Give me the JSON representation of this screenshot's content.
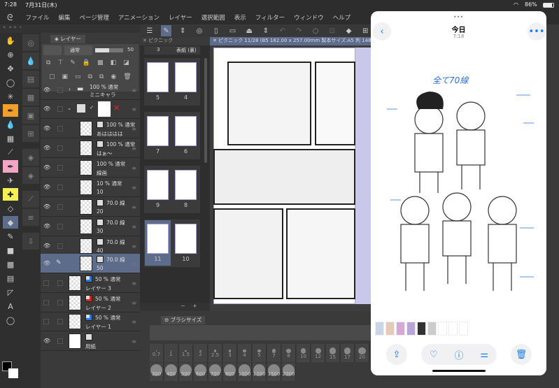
{
  "status": {
    "time": "7:28",
    "date": "7月31日(木)",
    "battery": "86%"
  },
  "menu": [
    "ファイル",
    "編集",
    "ページ管理",
    "アニメーション",
    "レイヤー",
    "選択範囲",
    "表示",
    "フィルター",
    "ウィンドウ",
    "ヘルプ"
  ],
  "layer_panel": {
    "tab": "レイヤー",
    "blend_mode": "通常",
    "opacity": "50",
    "layers": [
      {
        "line1": "100 % 通常",
        "line2": "ミニキャラ",
        "type": "folder",
        "visible": true
      },
      {
        "line1": "",
        "line2": "",
        "type": "group",
        "visible": true
      },
      {
        "line1": "100 % 通常",
        "line2": "あはははは",
        "type": "balloon",
        "visible": true
      },
      {
        "line1": "100 % 通常",
        "line2": "はぁ〜",
        "type": "balloon",
        "visible": true
      },
      {
        "line1": "100 % 通常",
        "line2": "線画",
        "type": "raster",
        "visible": true
      },
      {
        "line1": "10 % 通常",
        "line2": "10",
        "type": "raster",
        "visible": true
      },
      {
        "line1": "70.0 線",
        "line2": "20",
        "type": "tone",
        "visible": true
      },
      {
        "line1": "70.0 線",
        "line2": "30",
        "type": "tone",
        "visible": true
      },
      {
        "line1": "70.0 線",
        "line2": "40",
        "type": "tone",
        "visible": true
      },
      {
        "line1": "70.0 線",
        "line2": "50",
        "type": "tone",
        "visible": true,
        "selected": true
      },
      {
        "line1": "50 % 通常",
        "line2": "レイヤー 3",
        "type": "color",
        "visible": false
      },
      {
        "line1": "50 % 通常",
        "line2": "レイヤー 2",
        "type": "color",
        "visible": false
      },
      {
        "line1": "50 % 通常",
        "line2": "レイヤー 1",
        "type": "color",
        "visible": false
      },
      {
        "line1": "",
        "line2": "用紙",
        "type": "paper",
        "visible": true
      }
    ]
  },
  "page_manager": {
    "tab": "ピクニック",
    "cover_num": "3",
    "cover_label": "表紙 (裏)",
    "spreads": [
      [
        "5",
        "4"
      ],
      [
        "7",
        "6"
      ],
      [
        "9",
        "8"
      ],
      [
        "11",
        "10"
      ]
    ],
    "selected_page": "11"
  },
  "document_tab": "ピクニック 11/28 (B5 182.00 x 257.00mm 製本サイズ:A5 判 148.0",
  "brush_panel": {
    "tab": "ブラシサイズ",
    "row1": [
      "0.7",
      "1",
      "1.5",
      "2",
      "2.5",
      "3",
      "4",
      "5",
      "7",
      "8",
      "10",
      "12",
      "15",
      "17",
      "20"
    ],
    "row2": [
      "300",
      "400",
      "500",
      "600",
      "700",
      "800",
      "1000",
      "1200",
      "1500",
      "2000"
    ]
  },
  "photo_viewer": {
    "title": "今日",
    "time": "7:18",
    "annotation": "全て70線",
    "actions": [
      "share-icon",
      "heart-icon",
      "info-icon",
      "adjust-icon",
      "trash-icon"
    ],
    "accent": "#1a7cf5"
  }
}
